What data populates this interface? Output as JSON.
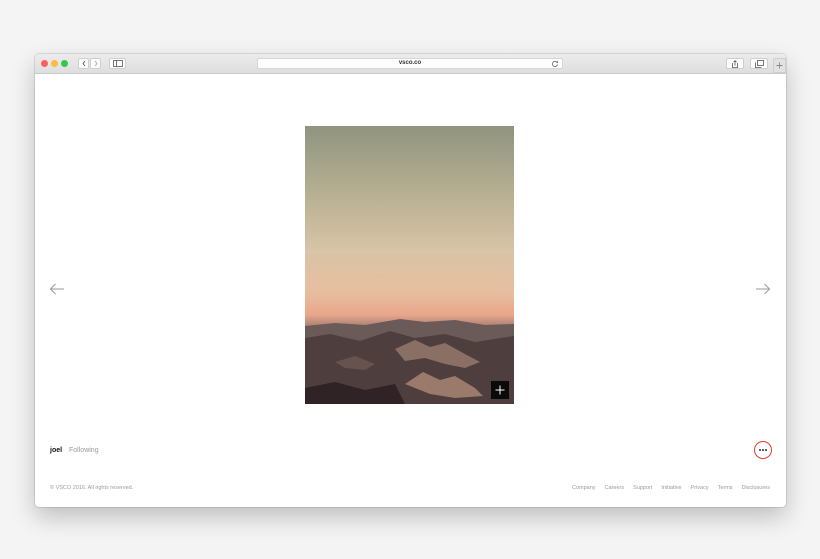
{
  "browser": {
    "url": "vsco.co"
  },
  "gallery": {
    "profile_name": "joel",
    "follow_status": "Following"
  },
  "footer": {
    "copyright": "© VSCO 2016. All rights reserved.",
    "links": [
      "Company",
      "Careers",
      "Support",
      "Initiative",
      "Privacy",
      "Terms",
      "Disclosures"
    ]
  },
  "colors": {
    "more_ring": "#e53d2f"
  }
}
